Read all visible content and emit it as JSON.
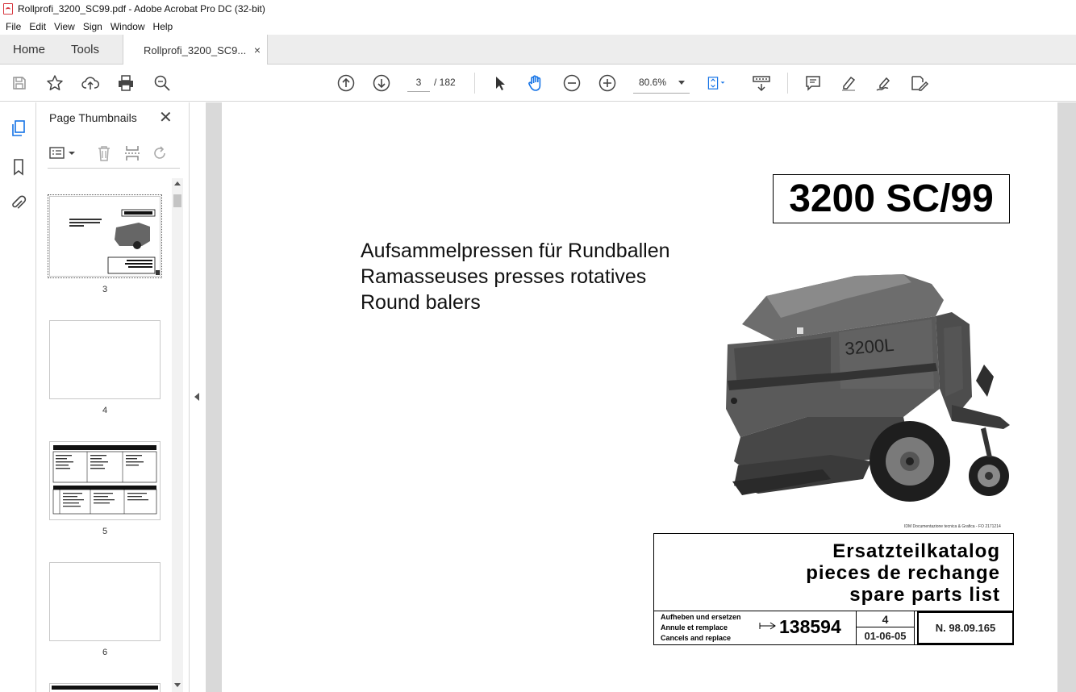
{
  "window": {
    "title": "Rollprofi_3200_SC99.pdf - Adobe Acrobat Pro DC (32-bit)"
  },
  "menu": [
    "File",
    "Edit",
    "View",
    "Sign",
    "Window",
    "Help"
  ],
  "tabs": {
    "home": "Home",
    "tools": "Tools",
    "doc": "Rollprofi_3200_SC9...",
    "close": "×"
  },
  "toolbar": {
    "page_current": "3",
    "page_total": "/  182",
    "zoom": "80.6%"
  },
  "thumbnails": {
    "title": "Page Thumbnails",
    "close": "✕",
    "pages": [
      {
        "label": "3",
        "selected": true
      },
      {
        "label": "4",
        "selected": false
      },
      {
        "label": "5",
        "selected": false
      },
      {
        "label": "6",
        "selected": false
      }
    ]
  },
  "document": {
    "model": "3200 SC/99",
    "subtitles": [
      "Aufsammelpressen für Rundballen",
      "Ramasseuses presses rotatives",
      "Round balers"
    ],
    "machine_label": "3200L",
    "credit": "IDM Documentazione tecnica & Grafica - FO   2171214",
    "catalog": [
      "Ersatzteilkatalog",
      "pieces de rechange",
      "spare parts list"
    ],
    "replace_text": [
      "Aufheben und ersetzen",
      "Annule et remplace",
      "Cancels and replace"
    ],
    "replace_number": "138594",
    "edition": "4",
    "date": "01-06-05",
    "doc_number": "N. 98.09.165"
  }
}
